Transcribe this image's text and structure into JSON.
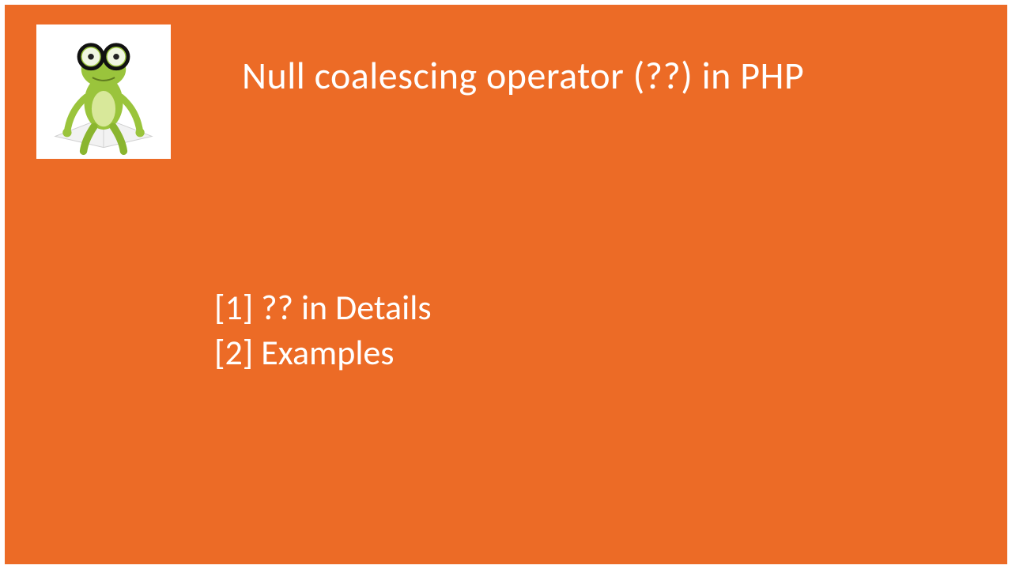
{
  "title": "Null coalescing operator (??) in PHP",
  "items": [
    "[1] ?? in Details",
    "[2] Examples"
  ],
  "logo_alt": "frog-reading-mascot"
}
